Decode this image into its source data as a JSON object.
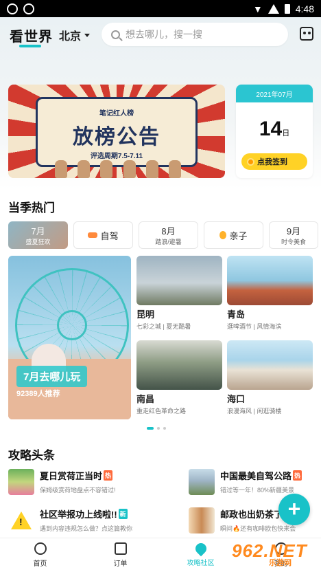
{
  "status_bar": {
    "time": "4:48"
  },
  "header": {
    "logo": "看世界",
    "city": "北京",
    "search_placeholder": "想去哪儿，搜一搜"
  },
  "banner": {
    "subtitle": "笔记红人榜",
    "title": "放榜公告",
    "period": "评选周期7.5-7.11"
  },
  "calendar": {
    "month": "2021年07月",
    "day": "14",
    "day_unit": "日",
    "checkin_label": "点我签到"
  },
  "season": {
    "title": "当季热门",
    "tags": [
      {
        "main": "7月",
        "sub": "盛夏狂欢"
      },
      {
        "main": "自驾",
        "sub": ""
      },
      {
        "main": "8月",
        "sub": "踏浪/避暑"
      },
      {
        "main": "亲子",
        "sub": ""
      },
      {
        "main": "9月",
        "sub": "时令美食"
      }
    ],
    "featured": {
      "label": "7月去哪儿玩",
      "sub": "92389人推荐"
    },
    "destinations": [
      {
        "name": "昆明",
        "desc": "七彩之城 | 夏无酷暑"
      },
      {
        "name": "青岛",
        "desc": "逛啤酒节 | 风情海滨"
      },
      {
        "name": "南昌",
        "desc": "重走红色革命之路"
      },
      {
        "name": "海口",
        "desc": "浪漫海风 | 闲逛骑楼"
      }
    ]
  },
  "strategy": {
    "title": "攻略头条",
    "items": [
      {
        "title": "夏日赏荷正当时",
        "badge": "热",
        "desc": "保姆级赏荷地盘点不容错过!"
      },
      {
        "title": "中国最美自驾公路",
        "badge": "热",
        "desc": "错过等一年！80%新疆美景"
      },
      {
        "title": "社区举报功上线啦!!",
        "badge": "新",
        "desc": "遇到内容违规怎么做？点这篇教你"
      },
      {
        "title": "邮政也出奶茶了",
        "badge": "",
        "desc": "瞬间🔥还有咖啡欧包快来会"
      }
    ]
  },
  "fab": {
    "label": "+"
  },
  "tabbar": {
    "items": [
      "首页",
      "订单",
      "攻略社区",
      "我的"
    ]
  },
  "watermark": {
    "num": "962.NET",
    "sub": "乐游网"
  }
}
